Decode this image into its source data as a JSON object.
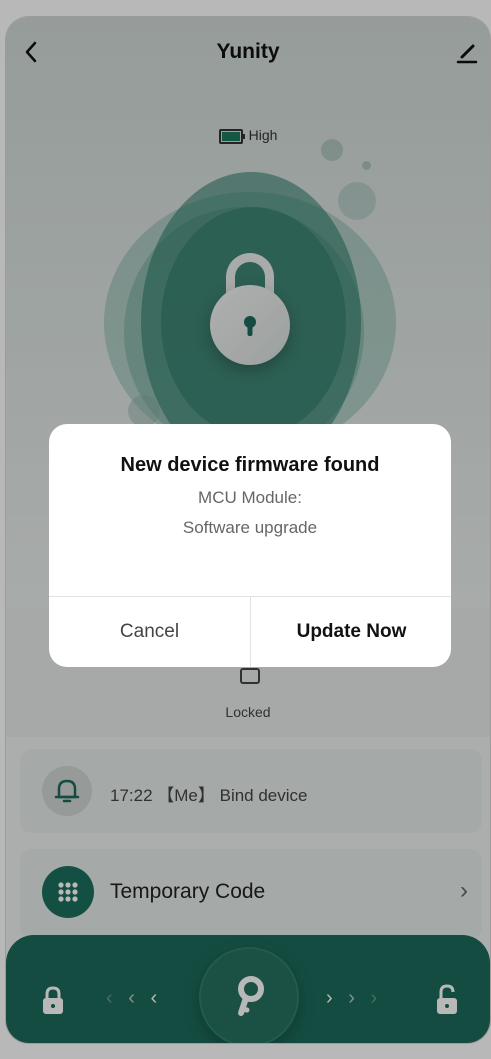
{
  "header": {
    "title": "Yunity",
    "back_icon": "chevron-left-icon",
    "edit_icon": "pencil-icon"
  },
  "battery": {
    "icon": "battery-icon",
    "level_label": "High",
    "color": "#1c7a5f"
  },
  "lock": {
    "icon": "padlock-icon",
    "status_label": "Locked"
  },
  "activity": {
    "icon": "bell-icon",
    "text": "17:22 【Me】 Bind device"
  },
  "temporary_code": {
    "icon": "keypad-icon",
    "label": "Temporary Code",
    "chevron": "›"
  },
  "bottom_bar": {
    "left_icon": "lock-closed-icon",
    "right_icon": "lock-open-icon",
    "center_icon": "key-icon",
    "left_arrows": [
      "‹",
      "‹",
      "‹"
    ],
    "right_arrows": [
      "›",
      "›",
      "›"
    ],
    "accent": "#1d6a5b"
  },
  "dialog": {
    "title": "New device firmware found",
    "line1": "MCU Module:",
    "line2": "Software upgrade",
    "cancel_label": "Cancel",
    "update_label": "Update Now"
  }
}
